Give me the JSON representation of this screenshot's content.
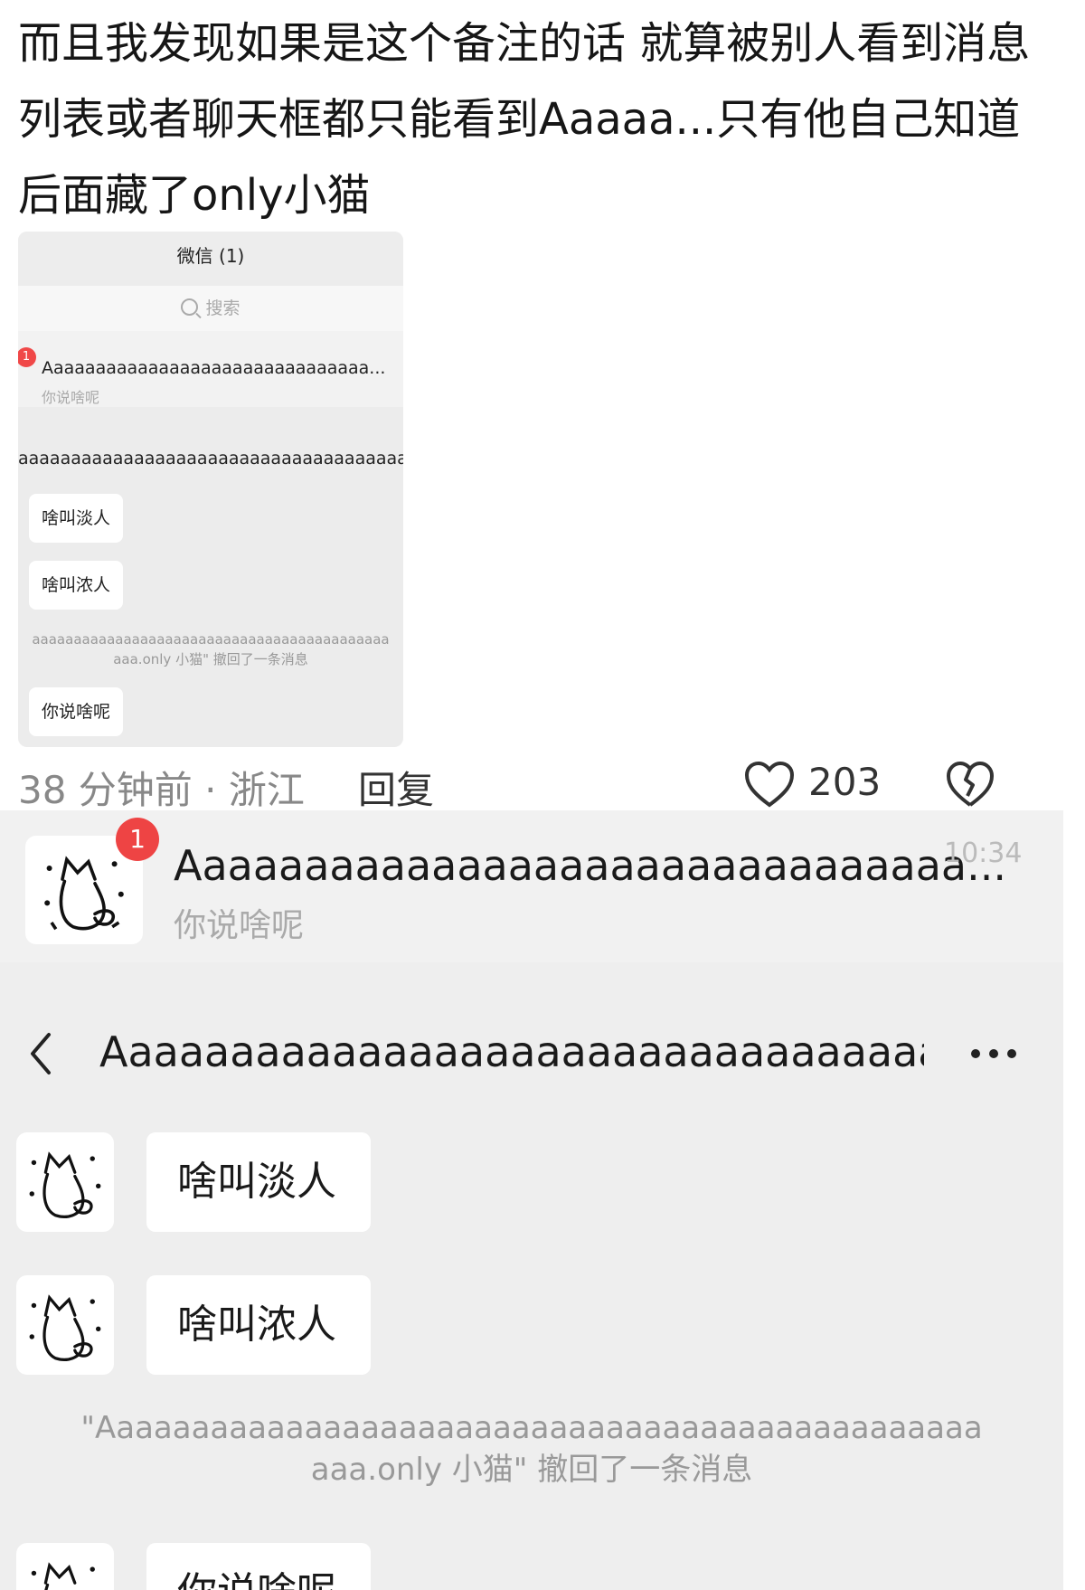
{
  "comment": {
    "text": "而且我发现如果是这个备注的话 就算被别人看到消息列表或者聊天框都只能看到Aaaaa...只有他自己知道后面藏了only小猫"
  },
  "mini_screenshot": {
    "header_title": "微信 (1)",
    "search_placeholder": "搜索",
    "badge": "1",
    "contact_name": "Aaaaaaaaaaaaaaaaaaaaaaaaaaaaaaa...",
    "contact_preview": "你说啥呢",
    "chat_title": "aaaaaaaaaaaaaaaaaaaaaaaaaaaaaaaaaaaaa",
    "bubble_1": "啥叫淡人",
    "bubble_2": "啥叫浓人",
    "recall_line1": "aaaaaaaaaaaaaaaaaaaaaaaaaaaaaaaaaaaaaaaaaaa",
    "recall_line2": "aaa.only 小猫\" 撤回了一条消息",
    "bubble_3": "你说啥呢"
  },
  "meta": {
    "time_location": "38 分钟前 · 浙江",
    "reply_label": "回复",
    "like_count": "203"
  },
  "big_screenshot": {
    "badge": "1",
    "contact_name": "Aaaaaaaaaaaaaaaaaaaaaaaaaaaaaaa...",
    "time": "10:34",
    "contact_preview": "你说啥呢",
    "chat_title": "Aaaaaaaaaaaaaaaaaaaaaaaaaaaaaaaaaaaaaaa",
    "bubble_1": "啥叫淡人",
    "bubble_2": "啥叫浓人",
    "recall_line1": "\"Aaaaaaaaaaaaaaaaaaaaaaaaaaaaaaaaaaaaaaaaaaaaaaa",
    "recall_line2": "aaa.only 小猫\" 撤回了一条消息",
    "bubble_3": "你说啥呢"
  }
}
